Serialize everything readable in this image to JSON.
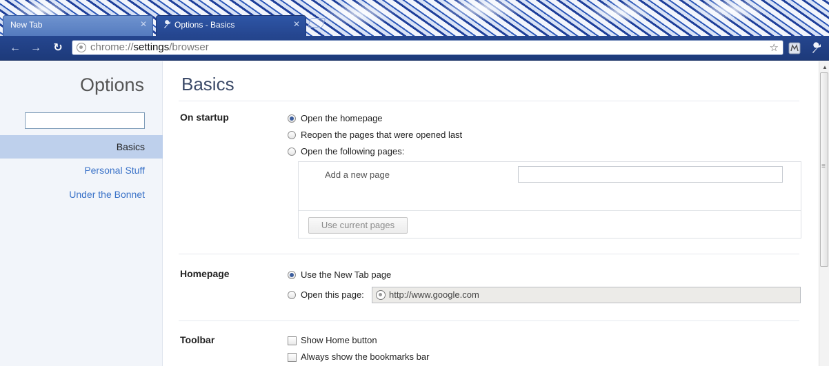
{
  "tabs": [
    {
      "label": "New Tab",
      "active": false
    },
    {
      "label": "Options - Basics",
      "active": true
    }
  ],
  "omnibox": {
    "url_prefix": "chrome://",
    "url_host": "settings",
    "url_path": "/browser"
  },
  "sidebar": {
    "title": "Options",
    "search_value": "",
    "items": [
      {
        "label": "Basics",
        "selected": true
      },
      {
        "label": "Personal Stuff",
        "selected": false
      },
      {
        "label": "Under the Bonnet",
        "selected": false
      }
    ]
  },
  "main": {
    "title": "Basics",
    "startup": {
      "label": "On startup",
      "options": [
        {
          "label": "Open the homepage",
          "checked": true
        },
        {
          "label": "Reopen the pages that were opened last",
          "checked": false
        },
        {
          "label": "Open the following pages:",
          "checked": false
        }
      ],
      "add_page_label": "Add a new page",
      "use_current_button": "Use current pages"
    },
    "homepage": {
      "label": "Homepage",
      "options": [
        {
          "label": "Use the New Tab page",
          "checked": true
        },
        {
          "label": "Open this page:",
          "checked": false
        }
      ],
      "url_value": "http://www.google.com"
    },
    "toolbar": {
      "label": "Toolbar",
      "options": [
        {
          "label": "Show Home button",
          "checked": false
        },
        {
          "label": "Always show the bookmarks bar",
          "checked": false
        }
      ]
    }
  },
  "colors": {
    "accent_link": "#3a72c8",
    "selected_item_bg": "#bed0ec",
    "frame_blue": "#25468f"
  }
}
